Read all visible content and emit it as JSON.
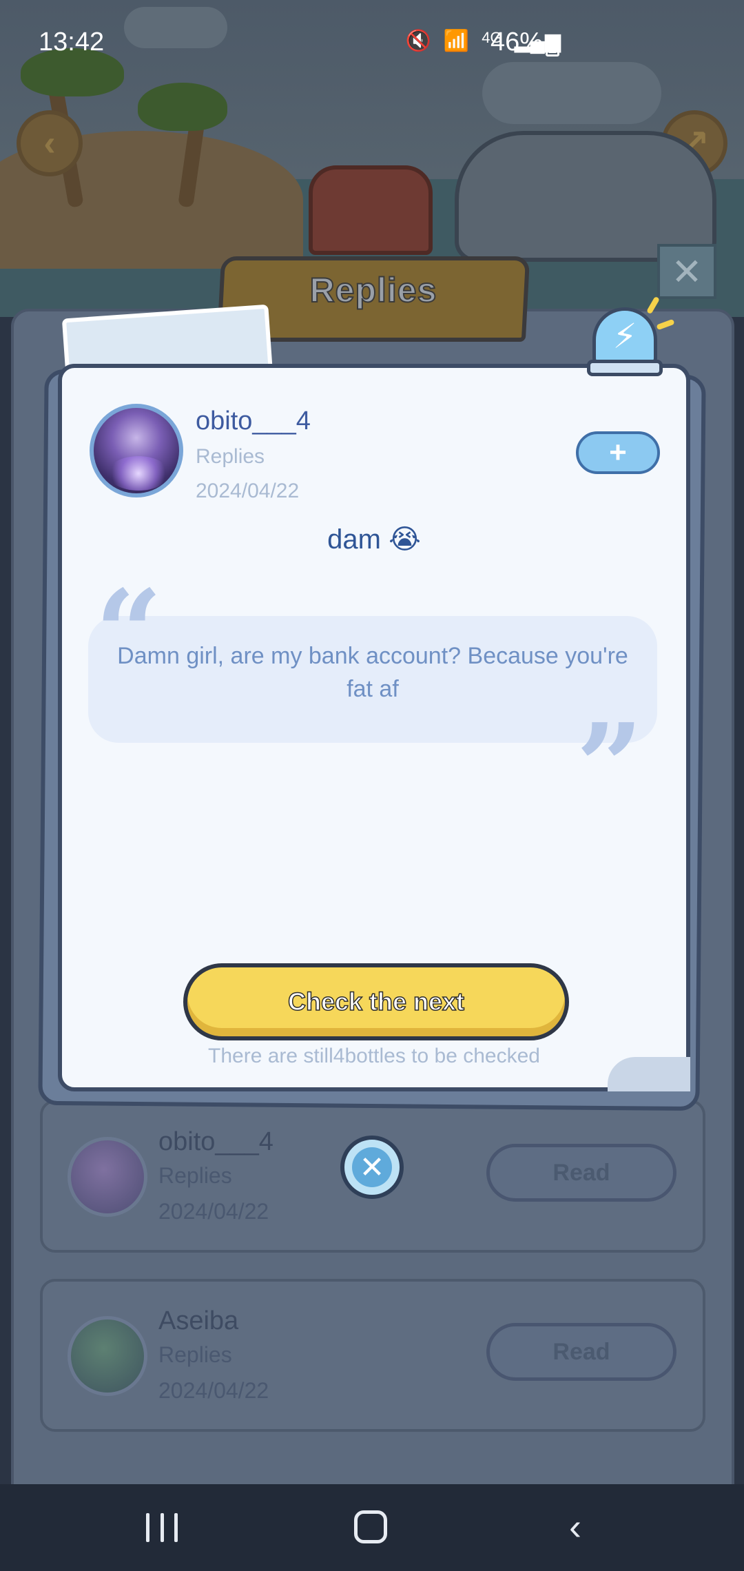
{
  "status_bar": {
    "time": "13:42",
    "network": "4G",
    "battery": "46%"
  },
  "panel": {
    "title": "Replies",
    "list": [
      {
        "name": "obito___4",
        "subtitle": "Replies",
        "date": "2024/04/22",
        "action": "Read"
      },
      {
        "name": "Aseiba",
        "subtitle": "Replies",
        "date": "2024/04/22",
        "action": "Read"
      }
    ]
  },
  "card": {
    "author": "obito___4",
    "subtitle": "Replies",
    "date": "2024/04/22",
    "add_icon": "+",
    "message": "dam 😭",
    "quote": "Damn girl, are my bank account? Because you're fat af",
    "next_button": "Check the next",
    "remaining": "There are still4bottles to be checked"
  },
  "icons": {
    "close": "✕",
    "lightning": "⚡",
    "back": "‹"
  },
  "colors": {
    "accent_yellow": "#f6d75a",
    "accent_blue": "#8cc9f1",
    "text_blue": "#3e5ba0",
    "muted": "#a9bad2"
  }
}
